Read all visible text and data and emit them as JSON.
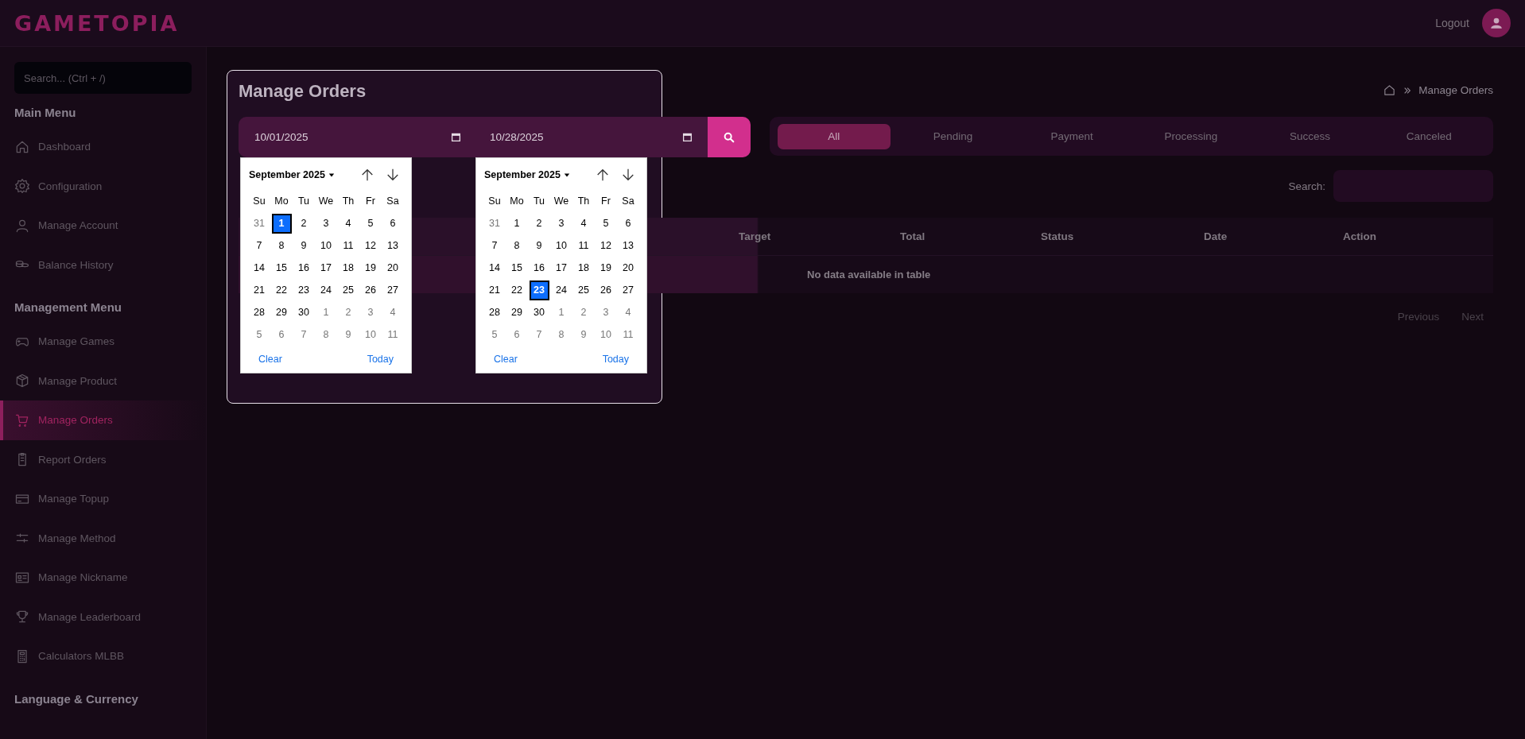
{
  "brand": {
    "logo": "GAMETOPIA"
  },
  "header": {
    "logout": "Logout"
  },
  "sidebar": {
    "search": {
      "placeholder": "Search... (Ctrl + /)"
    },
    "sections": [
      {
        "title": "Main Menu",
        "items": [
          {
            "label": "Dashboard",
            "selected": false
          },
          {
            "label": "Configuration",
            "selected": false
          },
          {
            "label": "Manage Account",
            "selected": false
          },
          {
            "label": "Balance History",
            "selected": false
          }
        ]
      },
      {
        "title": "Management Menu",
        "items": [
          {
            "label": "Manage Games",
            "selected": false
          },
          {
            "label": "Manage Product",
            "selected": false
          },
          {
            "label": "Manage Orders",
            "selected": true
          },
          {
            "label": "Report Orders",
            "selected": false
          },
          {
            "label": "Manage Topup",
            "selected": false
          },
          {
            "label": "Manage Method",
            "selected": false
          },
          {
            "label": "Manage Nickname",
            "selected": false
          },
          {
            "label": "Manage Leaderboard",
            "selected": false
          },
          {
            "label": "Calculators MLBB",
            "selected": false
          }
        ]
      },
      {
        "title": "Language & Currency"
      }
    ]
  },
  "page": {
    "title": "Manage Orders",
    "breadcrumb": "Manage Orders"
  },
  "filter": {
    "start_date": "10/01/2025",
    "end_date": "10/28/2025"
  },
  "calendars": [
    {
      "month": "September 2025",
      "weekdays": [
        "Su",
        "Mo",
        "Tu",
        "We",
        "Th",
        "Fr",
        "Sa"
      ],
      "clear": "Clear",
      "today": "Today",
      "days": [
        {
          "label": "31",
          "outside": true,
          "selected": false
        },
        {
          "label": "1",
          "outside": false,
          "selected": true
        },
        {
          "label": "2",
          "outside": false,
          "selected": false
        },
        {
          "label": "3",
          "outside": false,
          "selected": false
        },
        {
          "label": "4",
          "outside": false,
          "selected": false
        },
        {
          "label": "5",
          "outside": false,
          "selected": false
        },
        {
          "label": "6",
          "outside": false,
          "selected": false
        },
        {
          "label": "7",
          "outside": false,
          "selected": false
        },
        {
          "label": "8",
          "outside": false,
          "selected": false
        },
        {
          "label": "9",
          "outside": false,
          "selected": false
        },
        {
          "label": "10",
          "outside": false,
          "selected": false
        },
        {
          "label": "11",
          "outside": false,
          "selected": false
        },
        {
          "label": "12",
          "outside": false,
          "selected": false
        },
        {
          "label": "13",
          "outside": false,
          "selected": false
        },
        {
          "label": "14",
          "outside": false,
          "selected": false
        },
        {
          "label": "15",
          "outside": false,
          "selected": false
        },
        {
          "label": "16",
          "outside": false,
          "selected": false
        },
        {
          "label": "17",
          "outside": false,
          "selected": false
        },
        {
          "label": "18",
          "outside": false,
          "selected": false
        },
        {
          "label": "19",
          "outside": false,
          "selected": false
        },
        {
          "label": "20",
          "outside": false,
          "selected": false
        },
        {
          "label": "21",
          "outside": false,
          "selected": false
        },
        {
          "label": "22",
          "outside": false,
          "selected": false
        },
        {
          "label": "23",
          "outside": false,
          "selected": false
        },
        {
          "label": "24",
          "outside": false,
          "selected": false
        },
        {
          "label": "25",
          "outside": false,
          "selected": false
        },
        {
          "label": "26",
          "outside": false,
          "selected": false
        },
        {
          "label": "27",
          "outside": false,
          "selected": false
        },
        {
          "label": "28",
          "outside": false,
          "selected": false
        },
        {
          "label": "29",
          "outside": false,
          "selected": false
        },
        {
          "label": "30",
          "outside": false,
          "selected": false
        },
        {
          "label": "1",
          "outside": true,
          "selected": false
        },
        {
          "label": "2",
          "outside": true,
          "selected": false
        },
        {
          "label": "3",
          "outside": true,
          "selected": false
        },
        {
          "label": "4",
          "outside": true,
          "selected": false
        },
        {
          "label": "5",
          "outside": true,
          "selected": false
        },
        {
          "label": "6",
          "outside": true,
          "selected": false
        },
        {
          "label": "7",
          "outside": true,
          "selected": false
        },
        {
          "label": "8",
          "outside": true,
          "selected": false
        },
        {
          "label": "9",
          "outside": true,
          "selected": false
        },
        {
          "label": "10",
          "outside": true,
          "selected": false
        },
        {
          "label": "11",
          "outside": true,
          "selected": false
        }
      ]
    },
    {
      "month": "September 2025",
      "weekdays": [
        "Su",
        "Mo",
        "Tu",
        "We",
        "Th",
        "Fr",
        "Sa"
      ],
      "clear": "Clear",
      "today": "Today",
      "days": [
        {
          "label": "31",
          "outside": true,
          "selected": false
        },
        {
          "label": "1",
          "outside": false,
          "selected": false
        },
        {
          "label": "2",
          "outside": false,
          "selected": false
        },
        {
          "label": "3",
          "outside": false,
          "selected": false
        },
        {
          "label": "4",
          "outside": false,
          "selected": false
        },
        {
          "label": "5",
          "outside": false,
          "selected": false
        },
        {
          "label": "6",
          "outside": false,
          "selected": false
        },
        {
          "label": "7",
          "outside": false,
          "selected": false
        },
        {
          "label": "8",
          "outside": false,
          "selected": false
        },
        {
          "label": "9",
          "outside": false,
          "selected": false
        },
        {
          "label": "10",
          "outside": false,
          "selected": false
        },
        {
          "label": "11",
          "outside": false,
          "selected": false
        },
        {
          "label": "12",
          "outside": false,
          "selected": false
        },
        {
          "label": "13",
          "outside": false,
          "selected": false
        },
        {
          "label": "14",
          "outside": false,
          "selected": false
        },
        {
          "label": "15",
          "outside": false,
          "selected": false
        },
        {
          "label": "16",
          "outside": false,
          "selected": false
        },
        {
          "label": "17",
          "outside": false,
          "selected": false
        },
        {
          "label": "18",
          "outside": false,
          "selected": false
        },
        {
          "label": "19",
          "outside": false,
          "selected": false
        },
        {
          "label": "20",
          "outside": false,
          "selected": false
        },
        {
          "label": "21",
          "outside": false,
          "selected": false
        },
        {
          "label": "22",
          "outside": false,
          "selected": false
        },
        {
          "label": "23",
          "outside": false,
          "selected": true
        },
        {
          "label": "24",
          "outside": false,
          "selected": false
        },
        {
          "label": "25",
          "outside": false,
          "selected": false
        },
        {
          "label": "26",
          "outside": false,
          "selected": false
        },
        {
          "label": "27",
          "outside": false,
          "selected": false
        },
        {
          "label": "28",
          "outside": false,
          "selected": false
        },
        {
          "label": "29",
          "outside": false,
          "selected": false
        },
        {
          "label": "30",
          "outside": false,
          "selected": false
        },
        {
          "label": "1",
          "outside": true,
          "selected": false
        },
        {
          "label": "2",
          "outside": true,
          "selected": false
        },
        {
          "label": "3",
          "outside": true,
          "selected": false
        },
        {
          "label": "4",
          "outside": true,
          "selected": false
        },
        {
          "label": "5",
          "outside": true,
          "selected": false
        },
        {
          "label": "6",
          "outside": true,
          "selected": false
        },
        {
          "label": "7",
          "outside": true,
          "selected": false
        },
        {
          "label": "8",
          "outside": true,
          "selected": false
        },
        {
          "label": "9",
          "outside": true,
          "selected": false
        },
        {
          "label": "10",
          "outside": true,
          "selected": false
        },
        {
          "label": "11",
          "outside": true,
          "selected": false
        }
      ]
    }
  ],
  "status_tabs": [
    {
      "label": "All",
      "selected": true
    },
    {
      "label": "Pending",
      "selected": false
    },
    {
      "label": "Payment",
      "selected": false
    },
    {
      "label": "Processing",
      "selected": false
    },
    {
      "label": "Success",
      "selected": false
    },
    {
      "label": "Canceled",
      "selected": false
    }
  ],
  "table": {
    "search_label": "Search:",
    "columns": [
      "Target",
      "Total",
      "Status",
      "Date",
      "Action"
    ],
    "empty": "No data available in table"
  },
  "pagination": {
    "previous": "Previous",
    "next": "Next"
  }
}
